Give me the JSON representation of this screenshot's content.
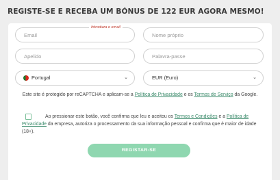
{
  "header": {
    "title": "REGISTE-SE E RECEBA UM BÓNUS DE 122 EUR AGORA MESMO!"
  },
  "form": {
    "email": {
      "placeholder": "Email",
      "hint": "Introduza o email"
    },
    "first_name": {
      "placeholder": "Nome próprio"
    },
    "last_name": {
      "placeholder": "Apelido"
    },
    "password": {
      "placeholder": "Palavra-passe"
    },
    "country": {
      "value": "Portugal"
    },
    "currency": {
      "value": "EUR (Euro)"
    },
    "recaptcha": {
      "text_1": "Este site é protegido por reCAPTCHA e aplicam-se a ",
      "privacy_link": "Política de Privacidade",
      "text_2": " e os ",
      "terms_link": "Termos de Serviço",
      "text_3": " da Google."
    },
    "consent": {
      "text_1": "Ao pressionar este botão, você confirma que leu e aceitou os ",
      "terms_link": "Termos e Condições",
      "text_2": " e a ",
      "privacy_link": "Política de Privacidade",
      "text_3": " da empresa, autoriza o processamento da sua informação pessoal e confirma que é maior de idade (18+)."
    },
    "submit_label": "REGISTAR-SE"
  },
  "colors": {
    "accent": "#8fd7b0",
    "link": "#3a8a6a",
    "error": "#c0392b"
  },
  "icons": {
    "country_flag": "portugal-flag-icon",
    "dropdown": "chevron-down-icon"
  }
}
